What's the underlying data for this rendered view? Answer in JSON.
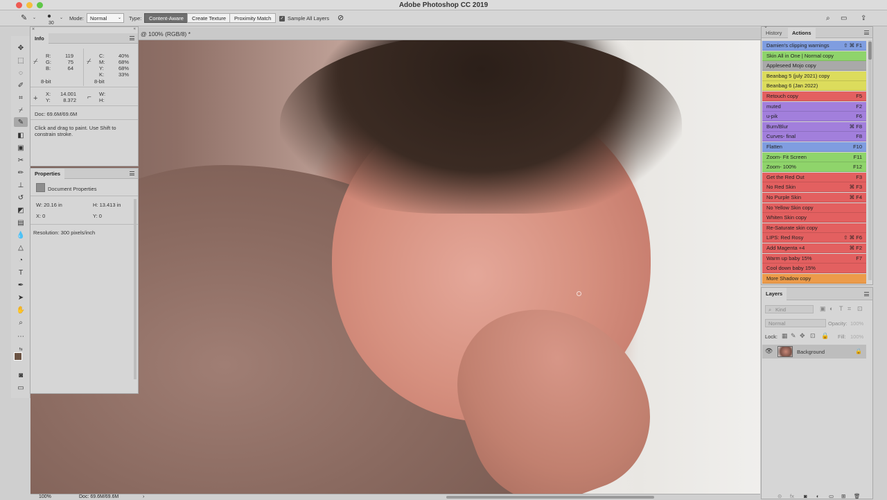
{
  "app": {
    "title": "Adobe Photoshop CC 2019"
  },
  "options": {
    "brush_size": "30",
    "mode_label": "Mode:",
    "mode_value": "Normal",
    "type_label": "Type:",
    "type_buttons": [
      "Content-Aware",
      "Create Texture",
      "Proximity Match"
    ],
    "sample_all_layers": "Sample All Layers"
  },
  "document": {
    "tab_title": "@ 100% (RGB/8) *"
  },
  "info_panel": {
    "title": "Info",
    "r": "R:",
    "r_val": "119",
    "g": "G:",
    "g_val": "75",
    "b": "B:",
    "b_val": "64",
    "c": "C:",
    "c_val": "40%",
    "m": "M:",
    "m_val": "68%",
    "y": "Y:",
    "y_val": "68%",
    "k": "K:",
    "k_val": "33%",
    "bit_left": "8-bit",
    "bit_right": "8-bit",
    "x": "X:",
    "x_val": "14.001",
    "ypos": "Y:",
    "ypos_val": "8.372",
    "w": "W:",
    "h": "H:",
    "doc": "Doc: 69.6M/69.6M",
    "hint": "Click and drag to paint. Use Shift to constrain stroke."
  },
  "properties_panel": {
    "title": "Properties",
    "doc_props": "Document Properties",
    "w": "W: 20.16 in",
    "h": "H: 13.413 in",
    "x": "X: 0",
    "y": "Y: 0",
    "resolution": "Resolution: 300 pixels/inch"
  },
  "actions_panel": {
    "tabs": [
      "History",
      "Actions"
    ],
    "items": [
      {
        "label": "Damien's clipping warnings",
        "key": "⇧ ⌘ F1",
        "color": "#7f9de0"
      },
      {
        "label": "Skin All in One | Normal copy",
        "key": "",
        "color": "#8fd46b"
      },
      {
        "label": "Appleseed Mojo copy",
        "key": "",
        "color": "#a9a9a9"
      },
      {
        "label": "Beanbag 5 (july 2021) copy",
        "key": "",
        "color": "#dcdc5c"
      },
      {
        "label": "Beanbag 6 (Jan 2022)",
        "key": "",
        "color": "#dcdc5c"
      },
      {
        "label": "Retouch copy",
        "key": "F5",
        "color": "#e36060"
      },
      {
        "label": "muted",
        "key": "F2",
        "color": "#a27fdc"
      },
      {
        "label": "u-pik",
        "key": "F6",
        "color": "#a27fdc"
      },
      {
        "label": "Burn/Blur",
        "key": "⌘ F8",
        "color": "#a27fdc"
      },
      {
        "label": "Curves- final",
        "key": "F8",
        "color": "#a27fdc"
      },
      {
        "label": "Flatten",
        "key": "F10",
        "color": "#7f9de0"
      },
      {
        "label": "Zoom- Fit Screen",
        "key": "F11",
        "color": "#8fd46b"
      },
      {
        "label": "Zoom- 100%",
        "key": "F12",
        "color": "#8fd46b"
      },
      {
        "label": "Get the Red Out",
        "key": "F3",
        "color": "#e36060"
      },
      {
        "label": "No Red Skin",
        "key": "⌘ F3",
        "color": "#e36060"
      },
      {
        "label": "No Purple Skin",
        "key": "⌘ F4",
        "color": "#e36060"
      },
      {
        "label": "No Yellow Skin copy",
        "key": "",
        "color": "#e36060"
      },
      {
        "label": "Whiten Skin copy",
        "key": "",
        "color": "#e36060"
      },
      {
        "label": "Re-Saturate skin copy",
        "key": "",
        "color": "#e36060"
      },
      {
        "label": "LIPS: Red Rosy",
        "key": "⇧ ⌘ F6",
        "color": "#e36060"
      },
      {
        "label": "Add Magenta +4",
        "key": "⌘ F2",
        "color": "#e36060"
      },
      {
        "label": "Warm up baby 15%",
        "key": "F7",
        "color": "#e36060"
      },
      {
        "label": "Cool down baby 15%",
        "key": "",
        "color": "#e36060"
      },
      {
        "label": "More Shadow copy",
        "key": "",
        "color": "#ec9b4a"
      }
    ]
  },
  "layers_panel": {
    "title": "Layers",
    "kind": "Kind",
    "blend": "Normal",
    "opacity": "Opacity:",
    "opacity_val": "100%",
    "lock": "Lock:",
    "fill": "Fill:",
    "fill_val": "100%",
    "layer_name": "Background"
  },
  "status": {
    "zoom": "100%",
    "doc": "Doc: 69.6M/69.6M"
  }
}
